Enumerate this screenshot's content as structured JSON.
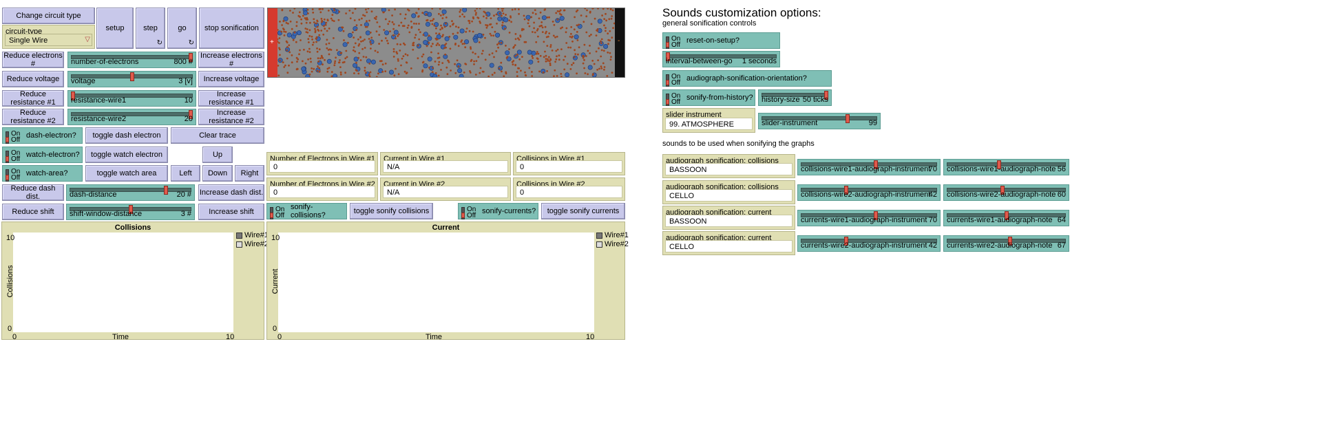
{
  "buttons": {
    "change_circuit_type": "Change circuit type",
    "setup": "setup",
    "step": "step",
    "go": "go",
    "stop_sonification": "stop sonification",
    "reduce_electrons": "Reduce electrons #",
    "increase_electrons": "Increase electrons #",
    "reduce_voltage": "Reduce voltage",
    "increase_voltage": "Increase voltage",
    "reduce_resistance_1": "Reduce resistance #1",
    "increase_resistance_1": "Increase resistance #1",
    "reduce_resistance_2": "Reduce resistance #2",
    "increase_resistance_2": "Increase resistance #2",
    "toggle_dash_electron": "toggle dash electron",
    "clear_trace": "Clear trace",
    "toggle_watch_electron": "toggle watch electron",
    "up": "Up",
    "toggle_watch_area": "toggle watch area",
    "left": "Left",
    "down": "Down",
    "right": "Right",
    "reduce_dash_dist": "Reduce dash dist.",
    "increase_dash_dist": "Increase dash dist.",
    "reduce_shift": "Reduce shift",
    "increase_shift": "Increase shift",
    "toggle_sonify_collisions": "toggle sonify collisions",
    "toggle_sonify_currents": "toggle sonify currents"
  },
  "chooser_circuit": {
    "label": "circuit-type",
    "value": "Single Wire"
  },
  "sliders": {
    "number_of_electrons": {
      "label": "number-of-electrons",
      "value": "800 #",
      "fraction": 1.0
    },
    "voltage": {
      "label": "voltage",
      "value": "3 [v]",
      "fraction": 0.5
    },
    "resistance_wire1": {
      "label": "resistance-wire1",
      "value": "10",
      "fraction": 0.0
    },
    "resistance_wire2": {
      "label": "resistance-wire2",
      "value": "20",
      "fraction": 1.0
    },
    "dash_distance": {
      "label": "dash-distance",
      "value": "20 #",
      "fraction": 0.8
    },
    "shift_window_distance": {
      "label": "shift-window-distance",
      "value": "3 #",
      "fraction": 0.5
    },
    "interval_between_go": {
      "label": "interval-between-go",
      "value": "1 seconds",
      "fraction": 0.0
    },
    "history_size": {
      "label": "history-size",
      "value": "50 ticks",
      "fraction": 1.0
    },
    "slider_instrument": {
      "label": "slider-instrument",
      "value": "99",
      "fraction": 0.75
    },
    "collisions_wire1_instrument": {
      "label": "collisions-wire1-audiograph-instrument",
      "value": "70",
      "fraction": 0.55
    },
    "collisions_wire1_note": {
      "label": "collisions-wire1-audiograph-note",
      "value": "56",
      "fraction": 0.44
    },
    "collisions_wire2_instrument": {
      "label": "collisions-wire2-audiograph-instrument",
      "value": "42",
      "fraction": 0.33
    },
    "collisions_wire2_note": {
      "label": "collisions-wire2-audiograph-note",
      "value": "60",
      "fraction": 0.47
    },
    "currents_wire1_instrument": {
      "label": "currents-wire1-audiograph-instrument",
      "value": "70",
      "fraction": 0.55
    },
    "currents_wire1_note": {
      "label": "currents-wire1-audiograph-note",
      "value": "64",
      "fraction": 0.5
    },
    "currents_wire2_instrument": {
      "label": "currents-wire2-audiograph-instrument",
      "value": "42",
      "fraction": 0.33
    },
    "currents_wire2_note": {
      "label": "currents-wire2-audiograph-note",
      "value": "67",
      "fraction": 0.53
    }
  },
  "switches": {
    "dash_electron": "dash-electron?",
    "watch_electron": "watch-electron?",
    "watch_area": "watch-area?",
    "sonify_collisions": "sonify-collisions?",
    "sonify_currents": "sonify-currents?",
    "reset_on_setup": "reset-on-setup?",
    "audiograph_orientation": "audiograph-sonification-orientation?",
    "sonify_from_history": "sonify-from-history?",
    "on": "On",
    "off": "Off"
  },
  "monitors": {
    "electrons_wire1": {
      "label": "Number of Electrons in Wire #1",
      "value": "0"
    },
    "current_wire1": {
      "label": "Current in Wire #1",
      "value": "N/A"
    },
    "collisions_wire1": {
      "label": "Collisions in Wire #1",
      "value": "0"
    },
    "electrons_wire2": {
      "label": "Number of Electrons in Wire #2",
      "value": "0"
    },
    "current_wire2": {
      "label": "Current in Wire #2",
      "value": "N/A"
    },
    "collisions_wire2": {
      "label": "Collisions in Wire #2",
      "value": "0"
    }
  },
  "sound_choosers": {
    "slider_instrument": {
      "label": "slider instrument",
      "value": "99. ATMOSPHERE"
    },
    "collisions_wire1": {
      "label": "audiograph sonification: collisions wire#1",
      "value": "BASSOON"
    },
    "collisions_wire2": {
      "label": "audiograph sonification: collisions wire#2",
      "value": "CELLO"
    },
    "current_wire1": {
      "label": "audiograph sonification: current wire#1",
      "value": "BASSOON"
    },
    "current_wire2": {
      "label": "audiograph sonification: current wire#2",
      "value": "CELLO"
    }
  },
  "plots": {
    "collisions": {
      "title": "Collisions",
      "ylabel": "Collisions",
      "xlabel": "Time",
      "ymax": "10",
      "ymin": "0",
      "xmin": "0",
      "xmax": "10",
      "legend": [
        "Wire#1",
        "Wire#2"
      ]
    },
    "current": {
      "title": "Current",
      "ylabel": "Current",
      "xlabel": "Time",
      "ymax": "10",
      "ymin": "0",
      "xmin": "0",
      "xmax": "10",
      "legend": [
        "Wire#1",
        "Wire#2"
      ]
    }
  },
  "right_panel": {
    "heading": "Sounds customization options:",
    "general_note": "general sonification controls",
    "graphs_note": "sounds to be used when sonifying the graphs"
  },
  "world": {
    "left_terminal": "+",
    "right_terminal": "-",
    "background_color": "#8c8c8c",
    "electron_color": "#a0461e",
    "nucleus_color": "#3a66b0"
  },
  "colors": {
    "button": "#c8c8ea",
    "slider": "#7fbfb5",
    "monitor": "#e0dfb4"
  }
}
